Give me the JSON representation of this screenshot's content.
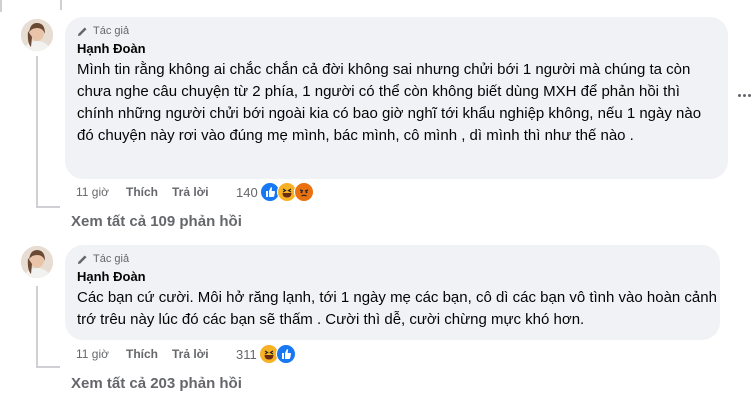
{
  "comments": [
    {
      "badge": "Tác giả",
      "author": "Hạnh Đoàn",
      "text": "Mình tin rằng không ai chắc chắn cả đời không sai nhưng chửi bới 1 người mà chúng ta còn chưa nghe câu chuyện từ 2 phía, 1 người có thể còn không biết dùng MXH để phản hồi thì chính những người chửi bới ngoài kia có bao giờ nghĩ tới khẩu nghiệp không, nếu 1 ngày nào đó chuyện này rơi vào đúng mẹ mình, bác mình, cô mình , dì mình thì như thế nào .",
      "time": "11 giờ",
      "like_label": "Thích",
      "reply_label": "Trả lời",
      "reaction_count": "140",
      "reactions": [
        "like-icon",
        "haha-icon",
        "angry-icon"
      ],
      "view_replies": "Xem tất cả 109 phản hồi"
    },
    {
      "badge": "Tác giả",
      "author": "Hạnh Đoàn",
      "text": "Các bạn cứ cười. Môi hở răng lạnh, tới 1 ngày mẹ các bạn, cô dì các bạn vô tình vào hoàn cảnh trớ trêu này lúc đó các bạn sẽ thấm . Cười thì dễ, cười chừng mực khó hơn.",
      "time": "11 giờ",
      "like_label": "Thích",
      "reply_label": "Trả lời",
      "reaction_count": "311",
      "reactions": [
        "haha-icon",
        "like-icon"
      ],
      "view_replies": "Xem tất cả 203 phản hồi"
    }
  ],
  "colors": {
    "bubble": "#f0f2f5",
    "secondary_text": "#65676b",
    "like_blue": "#1877f2",
    "haha_yellow": "#f7b125",
    "angry_red": "#e9710f"
  }
}
